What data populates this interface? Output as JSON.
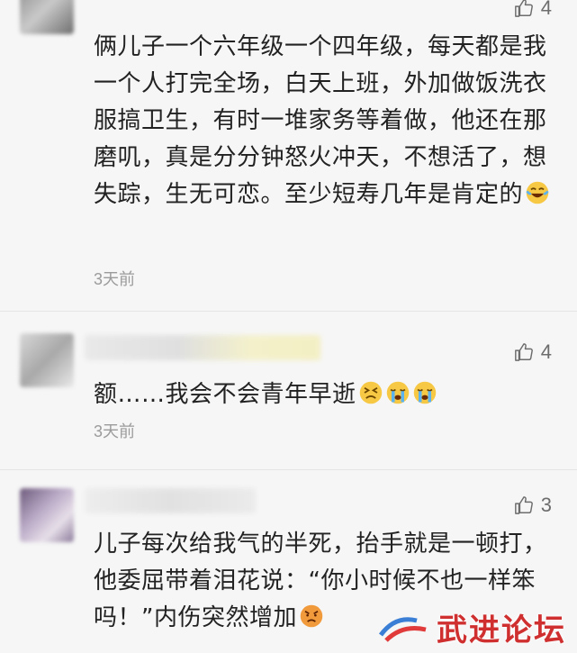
{
  "comments": [
    {
      "likes": "4",
      "text_before": "俩儿子一个六年级一个四年级，每天都是我一个人打完全场，白天上班，外加做饭洗衣服搞卫生，有时一堆家务等着做，他还在那磨叽，真是分分钟怒火冲天，不想活了，想失踪，生无可恋。至少短寿几年是肯定的",
      "time": "3天前"
    },
    {
      "likes": "4",
      "text_before": "额……我会不会青年早逝",
      "time": "3天前"
    },
    {
      "likes": "3",
      "text_before": "儿子每次给我气的半死，抬手就是一顿打，他委屈带着泪花说：“你小时候不也一样笨吗！”内伤突然增加"
    }
  ],
  "watermark": {
    "text": "武进论坛"
  },
  "icons": [
    "thumbs-up-icon",
    "laughing-tears-emoji",
    "persevering-emoji",
    "crying-emoji",
    "angry-emoji"
  ],
  "colors": {
    "background": "#f6f6f6",
    "text": "#222222",
    "muted": "#9b9b9b",
    "watermark": "#cf2f2f"
  }
}
